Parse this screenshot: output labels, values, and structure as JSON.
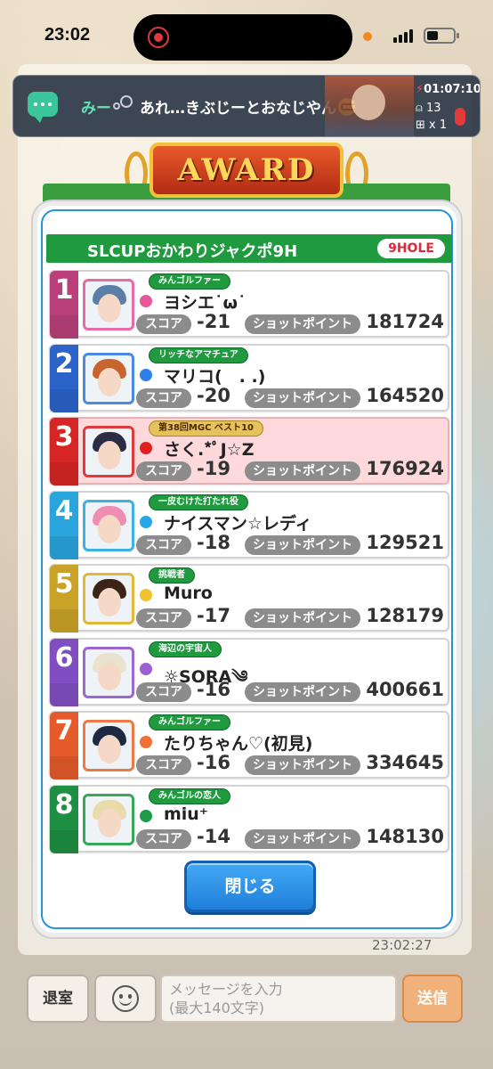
{
  "status_bar": {
    "time": "23:02"
  },
  "banner": {
    "sender": "みー",
    "message": "あれ…きぶじーとおなじやん",
    "timer": "01:07:10",
    "viewers": "13",
    "gifts": "x 1"
  },
  "award_title": "AWARD",
  "modal": {
    "title": "SLCUPおかわりジャクポ9H",
    "badge": "9HOLE",
    "score_label": "スコア",
    "sp_label": "ショットポイント",
    "close_label": "閉じる",
    "rows": [
      {
        "rank": "1",
        "title": "みんゴルファー",
        "name": "ヨシエ˙ω˙",
        "score": "-21",
        "shot_points": "181724",
        "rank_color": "#b9407a",
        "dot_color": "#e8559a",
        "avatar_border": "#e86aa8",
        "hair": "#5a7ea6",
        "highlight": false,
        "gold": false
      },
      {
        "rank": "2",
        "title": "リッチなアマチュア",
        "name": "マリコ(　. .)",
        "score": "-20",
        "shot_points": "164520",
        "rank_color": "#2b63c9",
        "dot_color": "#2f7fe8",
        "avatar_border": "#4a8ae0",
        "hair": "#c8642e",
        "highlight": false,
        "gold": false
      },
      {
        "rank": "3",
        "title": "第38回MGC ベスト10",
        "name": "さく.*ﾟJ☆Z",
        "score": "-19",
        "shot_points": "176924",
        "rank_color": "#d62525",
        "dot_color": "#e02020",
        "avatar_border": "#e03a3a",
        "hair": "#2c2c44",
        "highlight": true,
        "gold": true
      },
      {
        "rank": "4",
        "title": "一皮むけた打たれ役",
        "name": "ナイスマン☆レディ",
        "score": "-18",
        "shot_points": "129521",
        "rank_color": "#29a4dd",
        "dot_color": "#26a8e6",
        "avatar_border": "#3fb0e2",
        "hair": "#ef8db2",
        "highlight": false,
        "gold": false
      },
      {
        "rank": "5",
        "title": "挑戦者",
        "name": "Muro",
        "score": "-17",
        "shot_points": "128179",
        "rank_color": "#c9a227",
        "dot_color": "#f2c230",
        "avatar_border": "#e0b83a",
        "hair": "#3a2418",
        "highlight": false,
        "gold": false
      },
      {
        "rank": "6",
        "title": "海辺の宇宙人",
        "name": "☼SORA༄",
        "score": "-16",
        "shot_points": "400661",
        "rank_color": "#7f4fc2",
        "dot_color": "#9b5fd6",
        "avatar_border": "#9a68d0",
        "hair": "#e8e2cf",
        "highlight": false,
        "gold": false
      },
      {
        "rank": "7",
        "title": "みんゴルファー",
        "name": "たりちゃん♡(初見)",
        "score": "-16",
        "shot_points": "334645",
        "rank_color": "#e55b2c",
        "dot_color": "#f07030",
        "avatar_border": "#ec7a48",
        "hair": "#1e2a44",
        "highlight": false,
        "gold": false
      },
      {
        "rank": "8",
        "title": "みんゴルの恋人",
        "name": "miu⁺",
        "score": "-14",
        "shot_points": "148130",
        "rank_color": "#1f8f43",
        "dot_color": "#1e9a48",
        "avatar_border": "#35a85a",
        "hair": "#e8dcaa",
        "highlight": false,
        "gold": false
      }
    ]
  },
  "chat": {
    "timestamp": "23:02:27",
    "exit_label": "退室",
    "input_placeholder": "メッセージを入力\n(最大140文字)",
    "send_label": "送信"
  }
}
